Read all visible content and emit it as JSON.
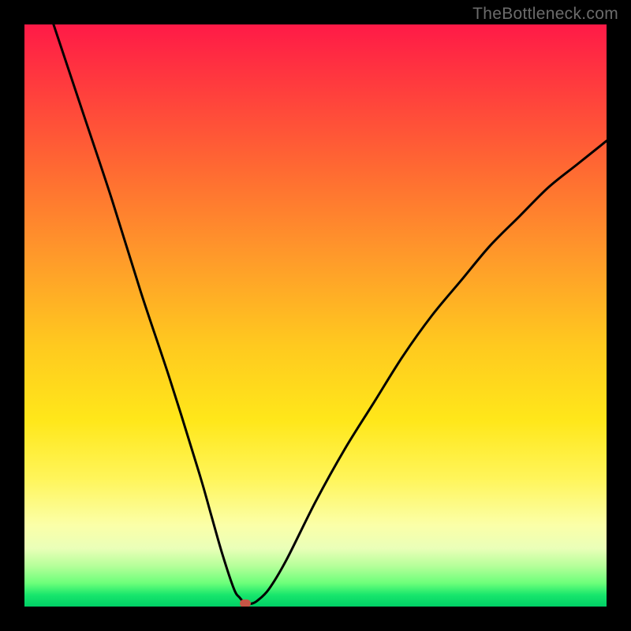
{
  "watermark": "TheBottleneck.com",
  "chart_data": {
    "type": "line",
    "title": "",
    "xlabel": "",
    "ylabel": "",
    "xlim": [
      0,
      100
    ],
    "ylim": [
      0,
      100
    ],
    "grid": false,
    "series": [
      {
        "name": "bottleneck-curve",
        "x": [
          5,
          10,
          15,
          20,
          25,
          30,
          32,
          34,
          36,
          37,
          38,
          39,
          40,
          42,
          45,
          50,
          55,
          60,
          65,
          70,
          75,
          80,
          85,
          90,
          95,
          100
        ],
        "values": [
          100,
          85,
          70,
          54,
          39,
          23,
          16,
          9,
          3,
          1.5,
          0.5,
          0.5,
          1,
          3,
          8,
          18,
          27,
          35,
          43,
          50,
          56,
          62,
          67,
          72,
          76,
          80
        ]
      }
    ],
    "marker": {
      "x": 38,
      "y": 0.5
    },
    "gradient_bands": [
      {
        "color": "#ff1a47",
        "position": 100
      },
      {
        "color": "#ffc91f",
        "position": 45
      },
      {
        "color": "#fff55a",
        "position": 22
      },
      {
        "color": "#00cf66",
        "position": 0
      }
    ]
  }
}
